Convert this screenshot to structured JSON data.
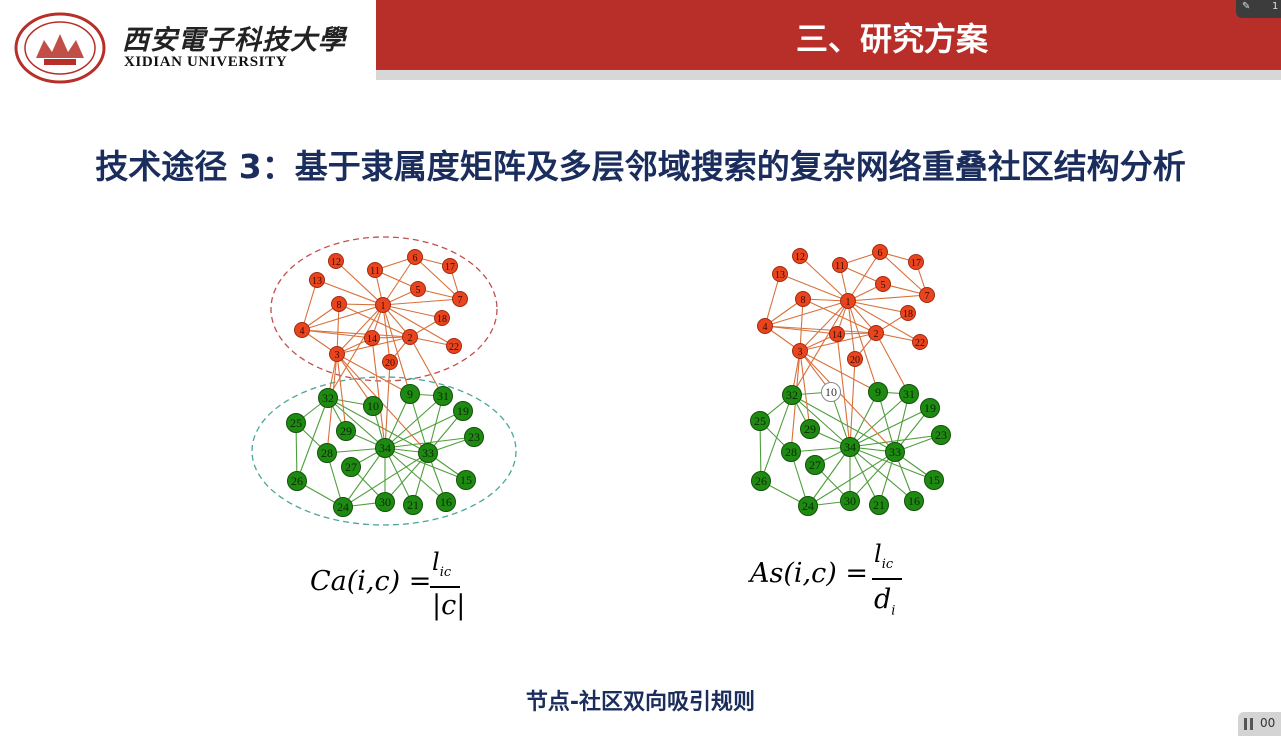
{
  "header": {
    "university_cn": "西安電子科技大學",
    "university_en": "XIDIAN UNIVERSITY",
    "section_title": "三、研究方案",
    "corner_text": "1"
  },
  "slide": {
    "title": "技术途径 3：基于隶属度矩阵及多层邻域搜索的复杂网络重叠社区结构分析",
    "caption": "节点-社区双向吸引规则"
  },
  "colors": {
    "red_band": "#b72f28",
    "title_navy": "#1a2d5c",
    "orange_node": "#e8451f",
    "orange_edge": "#d9703a",
    "green_node": "#1f8a12",
    "green_edge": "#4e9e3a",
    "overlap_node_fill": "#ffffff"
  },
  "network_left": {
    "nodes_orange": [
      "1",
      "2",
      "3",
      "4",
      "5",
      "6",
      "7",
      "8",
      "11",
      "12",
      "13",
      "14",
      "17",
      "18",
      "20",
      "22"
    ],
    "nodes_green": [
      "9",
      "10",
      "15",
      "16",
      "19",
      "21",
      "23",
      "24",
      "25",
      "26",
      "27",
      "28",
      "29",
      "30",
      "31",
      "32",
      "33",
      "34"
    ]
  },
  "network_right": {
    "nodes_orange": [
      "1",
      "2",
      "3",
      "4",
      "5",
      "6",
      "7",
      "8",
      "11",
      "12",
      "13",
      "14",
      "17",
      "18",
      "20",
      "22"
    ],
    "nodes_green": [
      "9",
      "15",
      "16",
      "19",
      "21",
      "23",
      "24",
      "25",
      "26",
      "27",
      "28",
      "29",
      "30",
      "31",
      "32",
      "33",
      "34"
    ],
    "node_white": "10"
  },
  "formula_left": {
    "lhs": "Ca(i,c) =",
    "numerator": "l",
    "numerator_sub": "ic",
    "denominator": "|c|"
  },
  "formula_right": {
    "lhs": "As(i,c) =",
    "numerator": "l",
    "numerator_sub": "ic",
    "denominator": "d",
    "denominator_sub": "i"
  },
  "status": {
    "pause_text": "00"
  }
}
